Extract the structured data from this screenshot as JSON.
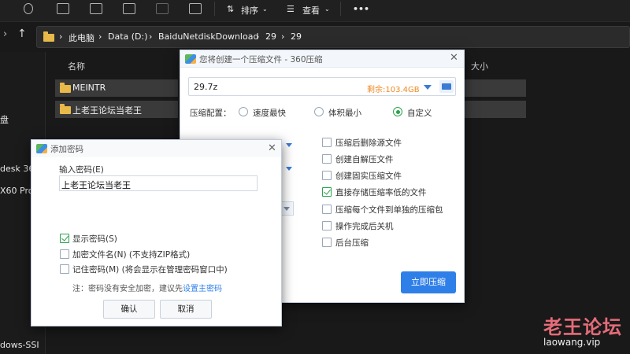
{
  "toolbar": {
    "sort_label": "排序",
    "view_label": "查看",
    "more_label": "•••"
  },
  "address": {
    "crumbs": [
      "此电脑",
      "Data (D:)",
      "BaiduNetdiskDownload",
      "29",
      "29"
    ]
  },
  "nav": {
    "items": [
      "盘",
      "desk 36",
      "X60 Pro",
      "dows-SSI"
    ]
  },
  "file_list": {
    "columns": {
      "name": "名称",
      "size": "大小"
    },
    "rows": [
      "MEINTR",
      "上老王论坛当老王"
    ]
  },
  "compress_dialog": {
    "title": "您将创建一个压缩文件 - 360压缩",
    "path_value": "29.7z",
    "free_space": "剩余:103.4GB",
    "config_label": "压缩配置：",
    "options": [
      "速度最快",
      "体积最小",
      "自定义"
    ],
    "selected_option": "自定义",
    "checkboxes": [
      {
        "label": "压缩后删除源文件",
        "checked": false
      },
      {
        "label": "创建自解压文件",
        "checked": false
      },
      {
        "label": "创建固实压缩文件",
        "checked": false
      },
      {
        "label": "直接存储压缩率低的文件",
        "checked": true
      },
      {
        "label": "压缩每个文件到单独的压缩包",
        "checked": false
      },
      {
        "label": "操作完成后关机",
        "checked": false
      },
      {
        "label": "后台压缩",
        "checked": false
      }
    ],
    "start_button": "立即压缩"
  },
  "password_dialog": {
    "title": "添加密码",
    "input_label": "输入密码(E)",
    "input_value": "上老王论坛当老王",
    "checkboxes": [
      {
        "label": "显示密码(S)",
        "checked": true
      },
      {
        "label": "加密文件名(N) (不支持ZIP格式)",
        "checked": false
      },
      {
        "label": "记住密码(M) (将会显示在管理密码窗口中)",
        "checked": false
      }
    ],
    "note_prefix": "注：密码没有安全加密，建议先",
    "note_link": "设置主密码",
    "ok_button": "确认",
    "cancel_button": "取消"
  },
  "watermark": {
    "line1": "老王论坛",
    "line2": "laowang.vip"
  },
  "colors": {
    "accent_blue": "#2f7fe8",
    "check_green": "#2ba24c",
    "free_space_orange": "#f08a24",
    "watermark_pink": "#e56c79"
  }
}
